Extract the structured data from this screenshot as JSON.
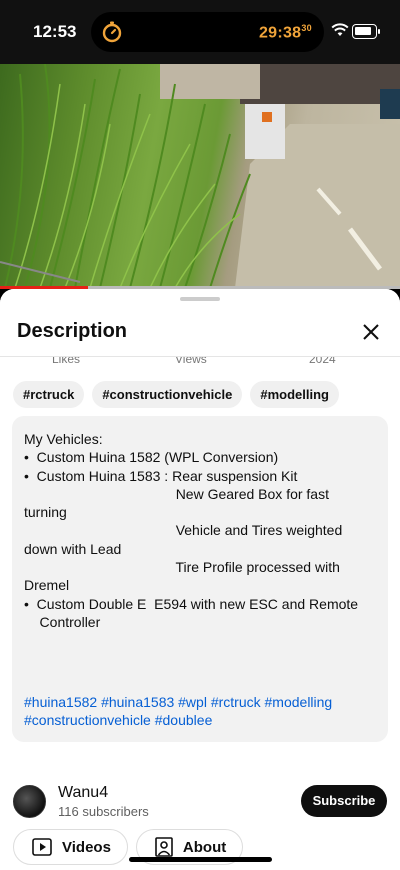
{
  "status_bar": {
    "time": "12:53",
    "timer": "29:38",
    "timer_sub": "30",
    "icons": [
      "timer-icon",
      "wifi-icon",
      "battery-icon"
    ]
  },
  "video": {
    "progress_fraction": 0.22
  },
  "description_panel": {
    "title": "Description",
    "stats": [
      "Likes",
      "Views",
      "2024"
    ],
    "hashtag_chips": [
      "#rctruck",
      "#constructionvehicle",
      "#modelling"
    ],
    "text_lines": [
      "My Vehicles:",
      "",
      "•  Custom Huina 1582 (WPL Conversion)",
      "•  Custom Huina 1583 : Rear suspension Kit",
      "                                       New Geared Box for fast",
      "turning",
      "                                       Vehicle and Tires weighted",
      "down with Lead",
      "                                       Tire Profile processed with",
      "Dremel",
      "•  Custom Double E  E594 with new ESC and Remote",
      "    Controller"
    ],
    "tag_links": "#huina1582 #huina1583 #wpl #rctruck #modelling #constructionvehicle #doublee"
  },
  "channel": {
    "name": "Wanu4",
    "subscribers": "116 subscribers",
    "subscribe_label": "Subscribe"
  },
  "buttons": {
    "videos": "Videos",
    "about": "About"
  },
  "colors": {
    "accent_red": "#e62117",
    "link_blue": "#065fd4",
    "timer_orange": "#f0a43a"
  }
}
